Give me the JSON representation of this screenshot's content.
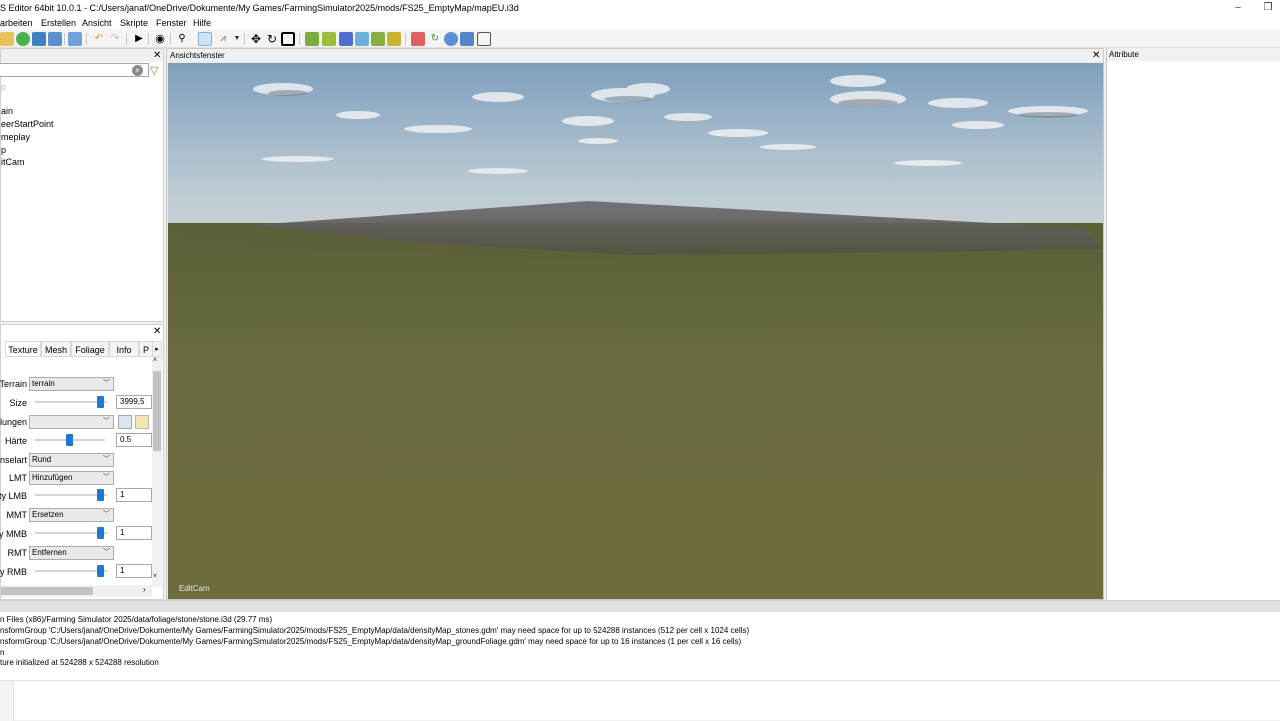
{
  "window": {
    "title": "S Editor 64bit 10.0.1 - C:/Users/janaf/OneDrive/Dokumente/My Games/FarmingSimulator2025/mods/FS25_EmptyMap/mapEU.i3d",
    "minimize": "–",
    "restore": "❐"
  },
  "menu": [
    "arbeiten",
    "Erstellen",
    "Ansicht",
    "Skripte",
    "Fenster",
    "Hilfe"
  ],
  "toolbar": {
    "icons": [
      "open-icon",
      "reload-icon",
      "save-icon",
      "save-as-icon",
      "import-icon",
      "undo-icon",
      "redo-icon",
      "play-icon",
      "view-icon",
      "zoom-icon",
      "select-icon",
      "terrain-tool-icon",
      "move-icon",
      "rotate-icon",
      "scale-icon"
    ]
  },
  "scene_panel": {
    "close": "✕",
    "search_value": "",
    "filter_icon": "filter-icon",
    "items": [
      "p",
      "ain",
      "eerStartPoint",
      "meplay",
      "p",
      "itCam"
    ]
  },
  "tool_panel": {
    "close": "✕",
    "tabs": [
      "Texture",
      "Mesh",
      "Foliage",
      "Info",
      "P"
    ],
    "scroll_arrow": "▸",
    "rows": {
      "terrain": {
        "label": "Terrain",
        "value": "terrain"
      },
      "size": {
        "label": "Size",
        "value": "3999,5",
        "level": 0.95
      },
      "einstellungen": {
        "label": "lungen",
        "value": ""
      },
      "haerte": {
        "label": "Härte",
        "value": "0.5",
        "level": 0.5
      },
      "pinselart": {
        "label": "inselart",
        "value": "Rund"
      },
      "lmt": {
        "label": "LMT",
        "value": "Hinzufügen"
      },
      "intensity_lmb": {
        "label": "ty LMB",
        "value": "1",
        "level": 1.0
      },
      "mmt": {
        "label": "MMT",
        "value": "Ersetzen"
      },
      "intensity_mmb": {
        "label": "y MMB",
        "value": "1",
        "level": 1.0
      },
      "rmt": {
        "label": "RMT",
        "value": "Entfernen"
      },
      "intensity_rmb": {
        "label": "ty RMB",
        "value": "1",
        "level": 1.0
      }
    }
  },
  "viewport": {
    "title": "Ansichtsfenster",
    "close": "✕",
    "camera_label": "EditCam"
  },
  "attribute_panel": {
    "title": "Attribute"
  },
  "log": {
    "lines": [
      "n Files (x86)/Farming Simulator 2025/data/foliage/stone/stone.i3d (29.77 ms)",
      "nsformGroup 'C:/Users/janaf/OneDrive/Dokumente/My Games/FarmingSimulator2025/mods/FS25_EmptyMap/data/densityMap_stones.gdm' may need space for up to 524288 instances (512 per cell x 1024 cells)",
      "nsformGroup 'C:/Users/janaf/OneDrive/Dokumente/My Games/FarmingSimulator2025/mods/FS25_EmptyMap/data/densityMap_groundFoliage.gdm' may need space for up to 16 instances (1 per cell x 16 cells)",
      "n",
      "ture initialized at 524288 x 524288 resolution"
    ]
  },
  "colors": {
    "accent": "#1f78d1",
    "sky_top": "#7f9fbd",
    "ground": "#6a6b40"
  }
}
